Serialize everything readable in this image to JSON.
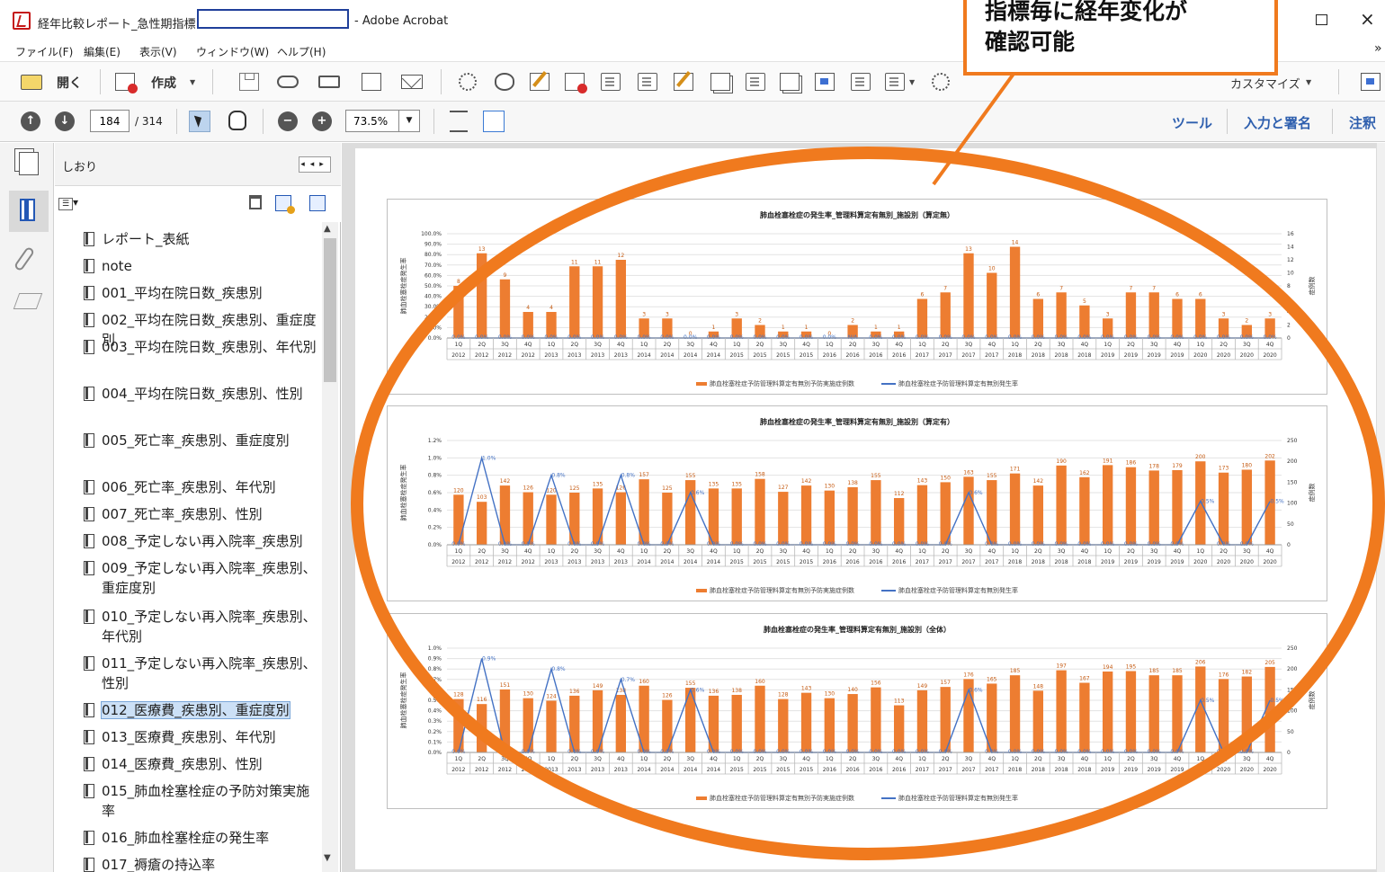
{
  "window": {
    "title_left": "経年比較レポート_急性期指標",
    "title_right": "- Adobe Acrobat",
    "maximize_icon": "□",
    "close_icon": "×"
  },
  "menu": {
    "items": [
      "ファイル(F)",
      "編集(E)",
      "表示(V)",
      "ウィンドウ(W)",
      "ヘルプ(H)"
    ],
    "more_icon": "»"
  },
  "toolbar": {
    "open_label": "開く",
    "create_label": "作成",
    "customize_label": "カスタマイズ"
  },
  "navigation": {
    "current_page": "184",
    "total_pages": "/ 314",
    "zoom": "73.5%"
  },
  "right_links": [
    "ツール",
    "入力と署名",
    "注釈"
  ],
  "bookmark_panel": {
    "title": "しおり",
    "items": [
      {
        "label": "レポート_表紙"
      },
      {
        "label": "note"
      },
      {
        "label": "001_平均在院日数_疾患別"
      },
      {
        "label": "002_平均在院日数_疾患別、重症度別"
      },
      {
        "label": "003_平均在院日数_疾患別、年代別"
      },
      {
        "label": "004_平均在院日数_疾患別、性別"
      },
      {
        "label": "005_死亡率_疾患別、重症度別"
      },
      {
        "label": "006_死亡率_疾患別、年代別"
      },
      {
        "label": "007_死亡率_疾患別、性別"
      },
      {
        "label": "008_予定しない再入院率_疾患別"
      },
      {
        "label": "009_予定しない再入院率_疾患別、重症度別"
      },
      {
        "label": "010_予定しない再入院率_疾患別、年代別"
      },
      {
        "label": "011_予定しない再入院率_疾患別、性別"
      },
      {
        "label": "012_医療費_疾患別、重症度別"
      },
      {
        "label": "013_医療費_疾患別、年代別"
      },
      {
        "label": "014_医療費_疾患別、性別"
      },
      {
        "label": "015_肺血栓塞栓症の予防対策実施率"
      },
      {
        "label": "016_肺血栓塞栓症の発生率"
      },
      {
        "label": "017_褥瘡の持込率"
      }
    ],
    "selected_index": 13
  },
  "callout": {
    "text": "指標毎に経年変化が\n確認可能",
    "color": "#f07a1e"
  },
  "colors": {
    "bar": "#ed7d31",
    "line": "#4472c4"
  },
  "chart_data": [
    {
      "type": "bar",
      "title": "肺血栓塞栓症の発生率_管理料算定有無別_施設別（算定無）",
      "ylabel": "肺血栓塞栓症発生率",
      "y2label": "症例数",
      "categories": [
        "1Q",
        "2Q",
        "3Q",
        "4Q",
        "1Q",
        "2Q",
        "3Q",
        "4Q",
        "1Q",
        "2Q",
        "3Q",
        "4Q",
        "1Q",
        "2Q",
        "3Q",
        "4Q",
        "1Q",
        "2Q",
        "3Q",
        "4Q",
        "1Q",
        "2Q",
        "3Q",
        "4Q",
        "1Q",
        "2Q",
        "3Q",
        "4Q",
        "1Q",
        "2Q",
        "3Q",
        "4Q",
        "1Q",
        "2Q",
        "3Q",
        "4Q"
      ],
      "years": [
        "2012",
        "2012",
        "2012",
        "2012",
        "2013",
        "2013",
        "2013",
        "2013",
        "2014",
        "2014",
        "2014",
        "2014",
        "2015",
        "2015",
        "2015",
        "2015",
        "2016",
        "2016",
        "2016",
        "2016",
        "2017",
        "2017",
        "2017",
        "2017",
        "2018",
        "2018",
        "2018",
        "2018",
        "2019",
        "2019",
        "2019",
        "2019",
        "2020",
        "2020",
        "2020",
        "2020"
      ],
      "y_ticks": [
        "0.0%",
        "10.0%",
        "20.0%",
        "30.0%",
        "40.0%",
        "50.0%",
        "60.0%",
        "70.0%",
        "80.0%",
        "90.0%",
        "100.0%"
      ],
      "y2_ticks": [
        "0",
        "2",
        "4",
        "6",
        "8",
        "10",
        "12",
        "14",
        "16"
      ],
      "y2lim": [
        0,
        16
      ],
      "ylim": [
        0,
        100
      ],
      "series": [
        {
          "name": "肺血栓塞栓症予防管理料算定有無別予防実施症例数",
          "kind": "bar",
          "values": [
            8,
            13,
            9,
            4,
            4,
            11,
            11,
            12,
            3,
            3,
            0,
            1,
            3,
            2,
            1,
            1,
            0,
            2,
            1,
            1,
            6,
            7,
            13,
            10,
            14,
            6,
            7,
            5,
            3,
            7,
            7,
            6,
            6,
            3,
            2,
            3
          ]
        },
        {
          "name": "肺血栓塞栓症予防管理料算定有無別発生率",
          "kind": "line",
          "values": [
            0,
            0,
            0,
            0,
            0,
            0,
            0,
            0,
            0,
            0,
            0,
            0,
            0,
            0,
            0,
            0,
            0,
            0,
            0,
            0,
            0,
            0,
            0,
            0,
            0,
            0,
            0,
            0,
            0,
            0,
            0,
            0,
            0,
            0,
            0,
            0
          ]
        }
      ],
      "bar_labels": [
        "8",
        "13",
        "9",
        "4",
        "4",
        "11",
        "11",
        "12",
        "3",
        "3",
        "0",
        "1",
        "3",
        "2",
        "1",
        "1",
        "0",
        "2",
        "1",
        "1",
        "6",
        "7",
        "13",
        "10",
        "14",
        "6",
        "7",
        "5",
        "3",
        "7",
        "7",
        "6",
        "6",
        "3",
        "2",
        "3"
      ],
      "line_labels": [
        "0.0%",
        "0.0%",
        "0.0%",
        "0.0%",
        "0.0%",
        "0.0%",
        "0.0%",
        "0.0%",
        "0.0%",
        "0.0%",
        "0.0%",
        "0.0%",
        "0.0%",
        "0.0%",
        "0.0%",
        "0.0%",
        "0.0%",
        "N/A",
        "0.0%",
        "0.0%",
        "0.0%",
        "0.0%",
        "0.0%",
        "0.0%",
        "0.0%",
        "0.0%",
        "0.0%",
        "0.0%",
        "0.0%",
        "0.0%",
        "0.0%",
        "0.0%",
        "0.0%",
        "0.0%",
        "0.0%",
        "0.0%"
      ]
    },
    {
      "type": "bar",
      "title": "肺血栓塞栓症の発生率_管理料算定有無別_施設別（算定有）",
      "ylabel": "肺血栓塞栓症発生率",
      "y2label": "症例数",
      "categories": [
        "1Q",
        "2Q",
        "3Q",
        "4Q",
        "1Q",
        "2Q",
        "3Q",
        "4Q",
        "1Q",
        "2Q",
        "3Q",
        "4Q",
        "1Q",
        "2Q",
        "3Q",
        "4Q",
        "1Q",
        "2Q",
        "3Q",
        "4Q",
        "1Q",
        "2Q",
        "3Q",
        "4Q",
        "1Q",
        "2Q",
        "3Q",
        "4Q",
        "1Q",
        "2Q",
        "3Q",
        "4Q",
        "1Q",
        "2Q",
        "3Q",
        "4Q"
      ],
      "years": [
        "2012",
        "2012",
        "2012",
        "2012",
        "2013",
        "2013",
        "2013",
        "2013",
        "2014",
        "2014",
        "2014",
        "2014",
        "2015",
        "2015",
        "2015",
        "2015",
        "2016",
        "2016",
        "2016",
        "2016",
        "2017",
        "2017",
        "2017",
        "2017",
        "2018",
        "2018",
        "2018",
        "2018",
        "2019",
        "2019",
        "2019",
        "2019",
        "2020",
        "2020",
        "2020",
        "2020"
      ],
      "y_ticks": [
        "0.0%",
        "0.2%",
        "0.4%",
        "0.6%",
        "0.8%",
        "1.0%",
        "1.2%"
      ],
      "y2_ticks": [
        "0",
        "50",
        "100",
        "150",
        "200",
        "250"
      ],
      "ylim": [
        0,
        1.2
      ],
      "y2lim": [
        0,
        250
      ],
      "series": [
        {
          "name": "肺血栓塞栓症予防管理料算定有無別予防実施症例数",
          "kind": "bar",
          "values": [
            120,
            103,
            142,
            126,
            120,
            125,
            135,
            126,
            157,
            125,
            155,
            135,
            135,
            158,
            127,
            142,
            130,
            138,
            155,
            112,
            143,
            150,
            163,
            155,
            171,
            142,
            190,
            162,
            191,
            186,
            178,
            179,
            200,
            173,
            180,
            202
          ]
        },
        {
          "name": "肺血栓塞栓症予防管理料算定有無別発生率",
          "kind": "line",
          "values": [
            0,
            1.0,
            0,
            0,
            0.8,
            0,
            0,
            0.8,
            0,
            0,
            0.6,
            0,
            0,
            0,
            0,
            0,
            0,
            0,
            0,
            0,
            0,
            0,
            0.6,
            0,
            0,
            0,
            0,
            0,
            0,
            0,
            0,
            0,
            0.5,
            0,
            0,
            0.5
          ]
        }
      ],
      "bar_labels": [
        "120",
        "103",
        "142",
        "126",
        "120",
        "125",
        "135",
        "126",
        "157",
        "125",
        "155",
        "135",
        "135",
        "158",
        "127",
        "142",
        "130",
        "138",
        "155",
        "112",
        "143",
        "150",
        "163",
        "155",
        "171",
        "142",
        "190",
        "162",
        "191",
        "186",
        "178",
        "179",
        "200",
        "173",
        "180",
        "202"
      ],
      "line_labels": [
        "0.0%",
        "1.0%",
        "0.0%",
        "0.0%",
        "0.8%",
        "0.0%",
        "0.0%",
        "0.8%",
        "0.0%",
        "0.0%",
        "0.6%",
        "0.0%",
        "0.0%",
        "0.0%",
        "0.0%",
        "0.0%",
        "0.0%",
        "0.0%",
        "0.0%",
        "0.0%",
        "0.0%",
        "0.0%",
        "0.6%",
        "0.0%",
        "0.0%",
        "0.0%",
        "0.0%",
        "0.0%",
        "0.0%",
        "0.0%",
        "0.0%",
        "0.0%",
        "0.5%",
        "0.0%",
        "0.0%",
        "0.5%"
      ]
    },
    {
      "type": "bar",
      "title": "肺血栓塞栓症の発生率_管理料算定有無別_施設別（全体）",
      "ylabel": "肺血栓塞栓症発生率",
      "y2label": "症例数",
      "categories": [
        "1Q",
        "2Q",
        "3Q",
        "4Q",
        "1Q",
        "2Q",
        "3Q",
        "4Q",
        "1Q",
        "2Q",
        "3Q",
        "4Q",
        "1Q",
        "2Q",
        "3Q",
        "4Q",
        "1Q",
        "2Q",
        "3Q",
        "4Q",
        "1Q",
        "2Q",
        "3Q",
        "4Q",
        "1Q",
        "2Q",
        "3Q",
        "4Q",
        "1Q",
        "2Q",
        "3Q",
        "4Q",
        "1Q",
        "2Q",
        "3Q",
        "4Q"
      ],
      "years": [
        "2012",
        "2012",
        "2012",
        "2012",
        "2013",
        "2013",
        "2013",
        "2013",
        "2014",
        "2014",
        "2014",
        "2014",
        "2015",
        "2015",
        "2015",
        "2015",
        "2016",
        "2016",
        "2016",
        "2016",
        "2017",
        "2017",
        "2017",
        "2017",
        "2018",
        "2018",
        "2018",
        "2018",
        "2019",
        "2019",
        "2019",
        "2019",
        "2020",
        "2020",
        "2020",
        "2020"
      ],
      "y_ticks": [
        "0.0%",
        "0.1%",
        "0.2%",
        "0.3%",
        "0.4%",
        "0.5%",
        "0.6%",
        "0.7%",
        "0.8%",
        "0.9%",
        "1.0%"
      ],
      "y2_ticks": [
        "0",
        "50",
        "100",
        "150",
        "200",
        "250"
      ],
      "ylim": [
        0,
        1.0
      ],
      "y2lim": [
        0,
        250
      ],
      "series": [
        {
          "name": "肺血栓塞栓症予防管理料算定有無別予防実施症例数",
          "kind": "bar",
          "values": [
            128,
            116,
            151,
            130,
            124,
            136,
            149,
            138,
            160,
            126,
            155,
            136,
            138,
            160,
            128,
            143,
            130,
            140,
            156,
            113,
            149,
            157,
            176,
            165,
            185,
            148,
            197,
            167,
            194,
            195,
            185,
            185,
            206,
            176,
            182,
            205
          ]
        },
        {
          "name": "肺血栓塞栓症予防管理料算定有無別発生率",
          "kind": "line",
          "values": [
            0,
            0.9,
            0,
            0,
            0.8,
            0,
            0,
            0.7,
            0,
            0,
            0.6,
            0,
            0,
            0,
            0,
            0,
            0,
            0,
            0,
            0,
            0,
            0,
            0.6,
            0,
            0,
            0,
            0,
            0,
            0,
            0,
            0,
            0,
            0.5,
            0,
            0,
            0.5
          ]
        }
      ],
      "bar_labels": [
        "128",
        "116",
        "151",
        "130",
        "124",
        "136",
        "149",
        "138",
        "160",
        "126",
        "155",
        "136",
        "138",
        "160",
        "128",
        "143",
        "130",
        "140",
        "156",
        "113",
        "149",
        "157",
        "176",
        "165",
        "185",
        "148",
        "197",
        "167",
        "194",
        "195",
        "185",
        "185",
        "206",
        "176",
        "182",
        "205"
      ],
      "line_labels": [
        "0.0%",
        "0.9%",
        "0.0%",
        "0.0%",
        "0.8%",
        "0.0%",
        "0.0%",
        "0.7%",
        "0.0%",
        "0.0%",
        "0.6%",
        "0.0%",
        "0.0%",
        "0.0%",
        "0.0%",
        "0.0%",
        "0.0%",
        "0.0%",
        "0.0%",
        "0.0%",
        "0.0%",
        "0.0%",
        "0.6%",
        "0.0%",
        "0.0%",
        "0.0%",
        "0.0%",
        "0.0%",
        "0.0%",
        "0.0%",
        "0.0%",
        "0.0%",
        "0.5%",
        "0.0%",
        "0.0%",
        "0.5%"
      ]
    }
  ]
}
